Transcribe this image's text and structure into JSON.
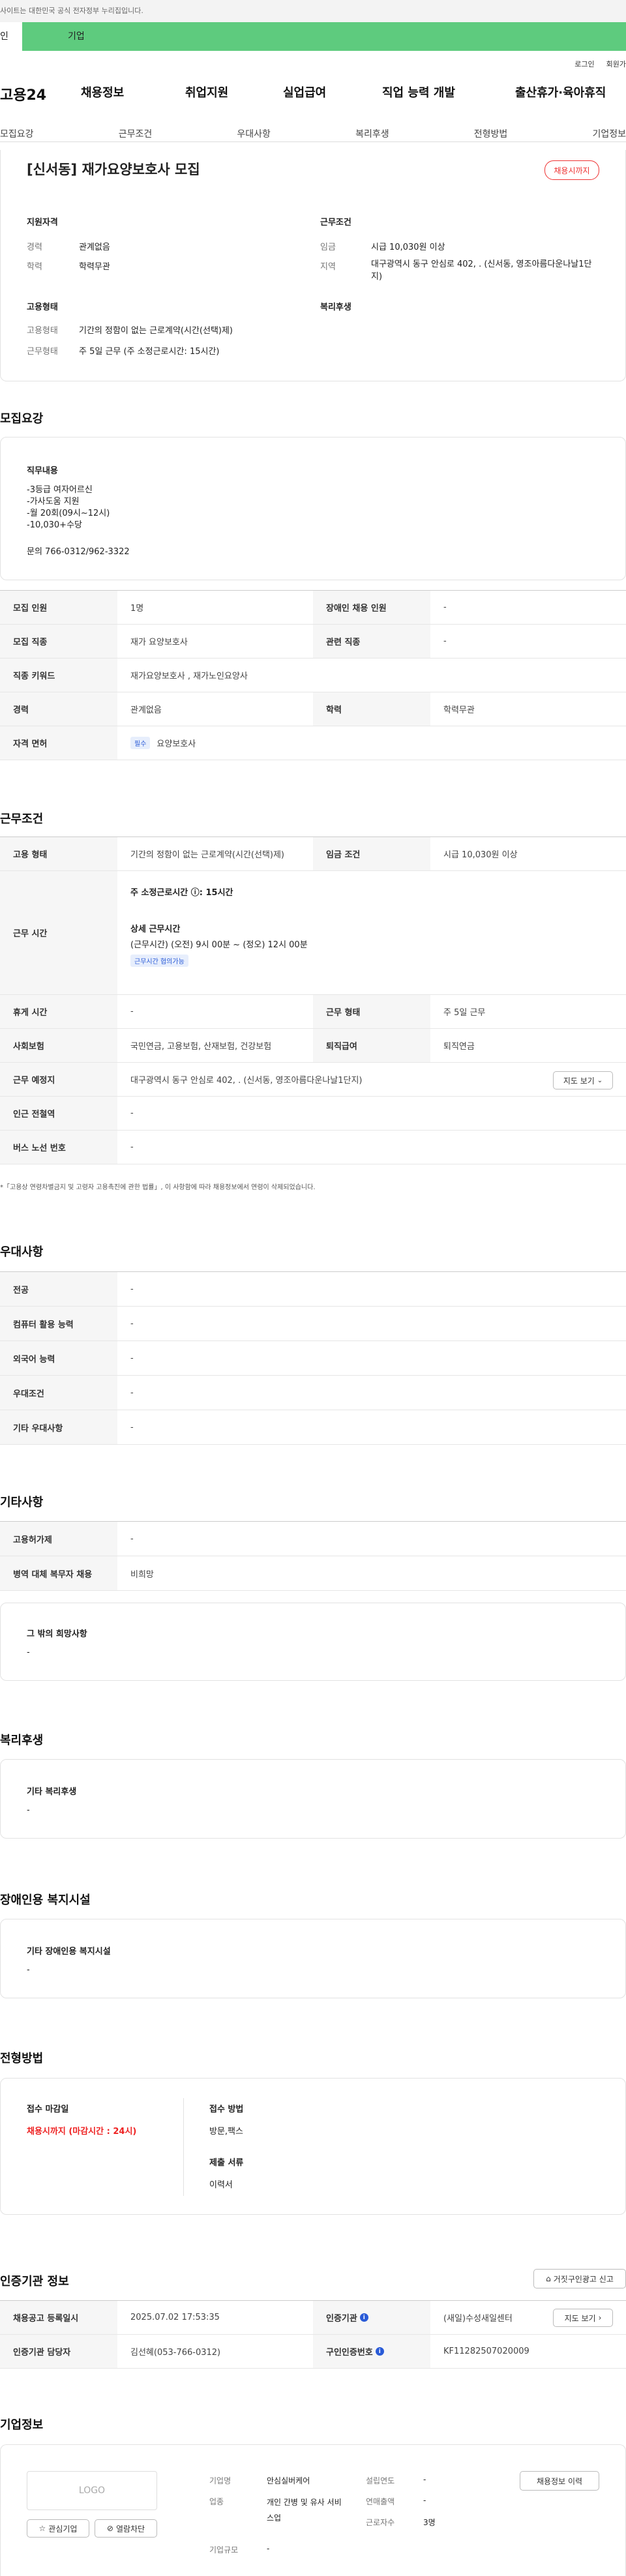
{
  "topbar": {
    "notice": "사이트는 대한민국 공식 전자정부 누리집입니다."
  },
  "typebar": {
    "personal": "인",
    "company": "기업"
  },
  "header": {
    "login": "로그인",
    "join": "회원가",
    "logo": "고용24"
  },
  "gnb": [
    "채용정보",
    "취업지원",
    "실업급여",
    "직업 능력 개발",
    "출산휴가·육아휴직"
  ],
  "tabs": [
    "모집요강",
    "근무조건",
    "우대사항",
    "복리후생",
    "전형방법",
    "기업정보"
  ],
  "summary": {
    "title": "[신서동] 재가요양보호사 모집",
    "badge": "채용시까지",
    "qual_title": "지원자격",
    "career_label": "경력",
    "career": "관계없음",
    "edu_label": "학력",
    "edu": "학력무관",
    "cond_title": "근무조건",
    "wage_label": "임금",
    "wage": "시급 10,030원 이상",
    "region_label": "지역",
    "region": "대구광역시 동구 안심로 402, . (신서동, 영조아름다운나날1단지)",
    "emp_title": "고용형태",
    "emp_label": "고용형태",
    "emp": "기간의 정함이 없는 근로계약(시간(선택)제)",
    "workform_label": "근무형태",
    "workform": "주 5일 근무 (주 소정근로시간: 15시간)",
    "welfare_title": "복리후생"
  },
  "recruit": {
    "title": "모집요강",
    "duty_title": "직무내용",
    "duty": [
      "-3등급 여자어르신",
      "-가사도움 지원",
      "-월 20회(09시~12시)",
      "-10,030+수당"
    ],
    "contact": "문의 766-0312/962-3322",
    "rows": [
      {
        "l1": "모집 인원",
        "v1": "1명",
        "l2": "장애인 채용 인원",
        "v2": "-"
      },
      {
        "l1": "모집 직종",
        "v1": "재가 요양보호사",
        "l2": "관련 직종",
        "v2": "-"
      }
    ],
    "keyword_label": "직종 키워드",
    "keyword": "재가요양보호사 , 재가노인요양사",
    "career_label": "경력",
    "career": "관계없음",
    "edu_label": "학력",
    "edu": "학력무관",
    "license_label": "자격 면허",
    "license_tag": "필수",
    "license": "요양보호사"
  },
  "work": {
    "title": "근무조건",
    "emp_label": "고용 형태",
    "emp": "기간의 정함이 없는 근로계약(시간(선택)제)",
    "wage_label": "임금 조건",
    "wage": "시급 10,030원 이상",
    "time_label": "근무 시간",
    "hours": "주 소정근로시간 ⓘ: 15시간",
    "detail_title": "상세 근무시간",
    "detail": "(근무시간) (오전) 9시 00분 ~ (정오) 12시 00분",
    "negotiable": "근무시간 협의가능",
    "holiday_label": "휴게 시간",
    "holiday": "-",
    "workform_label": "근무 형태",
    "workform": "주 5일 근무",
    "insurance_label": "사회보험",
    "insurance": "국민연금, 고용보험, 산재보험, 건강보험",
    "severance_label": "퇴직급여",
    "severance": "퇴직연금",
    "place_label": "근무 예정지",
    "place": "대구광역시 동구 안심로 402, . (신서동, 영조아름다운나날1단지)",
    "map_btn": "지도 보기",
    "subway_label": "인근 전철역",
    "subway": "-",
    "bus_label": "버스 노선 번호",
    "bus": "-",
    "note": "*「고용상 연령차별금지 및 고령자 고용촉진에 관한 법률」, 이 사항함에 따라 채용정보에서 연령이 삭제되었습니다."
  },
  "pref": {
    "title": "우대사항",
    "rows": [
      [
        "전공",
        "-"
      ],
      [
        "컴퓨터 활용 능력",
        "-"
      ],
      [
        "외국어 능력",
        "-"
      ],
      [
        "우대조건",
        "-"
      ],
      [
        "기타 우대사항",
        "-"
      ]
    ]
  },
  "etc": {
    "title": "기타사항",
    "rows": [
      [
        "고용허가제",
        "-"
      ],
      [
        "병역 대체 복무자 채용",
        "비희망"
      ]
    ],
    "other_title": "그 밖의 희망사항",
    "other": "-"
  },
  "welfare": {
    "title": "복리후생",
    "sub": "기타 복리후생",
    "val": "-"
  },
  "disabled": {
    "title": "장애인용 복지시설",
    "sub": "기타 장애인용 복지시설",
    "val": "-"
  },
  "process": {
    "title": "전형방법",
    "deadline_label": "접수 마감일",
    "deadline": "채용시까지 (마감시간 : 24시)",
    "method_label": "접수 방법",
    "method": "방문,팩스",
    "docs_label": "제출 서류",
    "docs": "이력서"
  },
  "cert": {
    "title": "인증기관 정보",
    "report_btn": "거짓구인광고 신고",
    "reg_label": "채용공고 등록일시",
    "reg": "2025.07.02 17:53:35",
    "org_label": "인증기관",
    "org": "(새일)수성새일센터",
    "map_btn": "지도 보기",
    "manager_label": "인증기관 담당자",
    "manager": "김선혜(053-766-0312)",
    "num_label": "구인인증번호",
    "num": "KF11282507020009"
  },
  "company": {
    "title": "기업정보",
    "logo": "LOGO",
    "fav": "관심기업",
    "block": "열람차단",
    "history_btn": "채용정보 이력",
    "name_label": "기업명",
    "name": "안심실버케어",
    "industry_label": "업종",
    "industry": "개인 간병 및 유사 서비스업",
    "size_label": "기업규모",
    "size": "-",
    "year_label": "설립연도",
    "year": "-",
    "sales_label": "연매출액",
    "sales": "-",
    "emp_label": "근로자수",
    "emp": "3명"
  }
}
